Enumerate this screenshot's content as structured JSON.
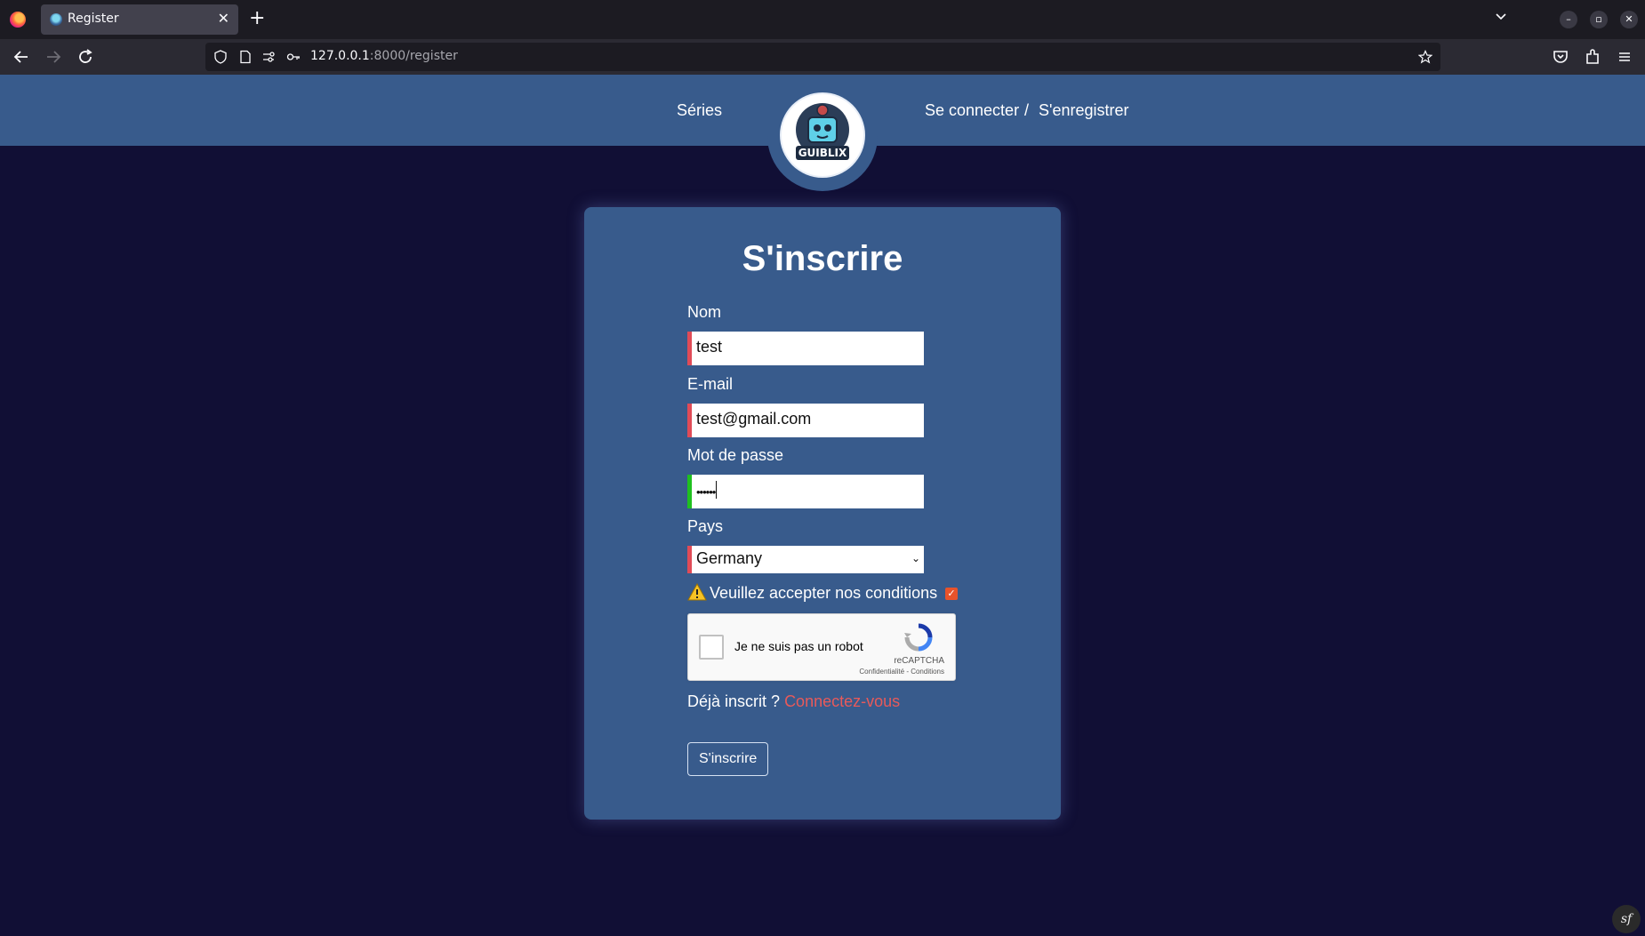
{
  "browser": {
    "tab_title": "Register",
    "url_host": "127.0.0.1",
    "url_rest": ":8000/register"
  },
  "header": {
    "series_link": "Séries",
    "login_link": "Se connecter",
    "separator": "/",
    "register_link": "S'enregistrer",
    "logo_text": "GUIBLIX"
  },
  "form": {
    "title": "S'inscrire",
    "name_label": "Nom",
    "name_value": "test",
    "email_label": "E-mail",
    "email_value": "test@gmail.com",
    "password_label": "Mot de passe",
    "password_value": "••••••",
    "country_label": "Pays",
    "country_value": "Germany",
    "terms_label": "Veuillez accepter nos conditions",
    "terms_checked": true,
    "recaptcha_text": "Je ne suis pas un robot",
    "recaptcha_brand": "reCAPTCHA",
    "recaptcha_links": "Confidentialité - Conditions",
    "already_text": "Déjà inscrit ?",
    "login_prompt": "Connectez-vous",
    "submit_label": "S'inscrire"
  },
  "colors": {
    "page_bg": "#110f35",
    "header_bg": "#385b8c",
    "invalid_border": "#e04b57",
    "valid_border": "#1fc01f",
    "link_accent": "#e85a5a"
  }
}
